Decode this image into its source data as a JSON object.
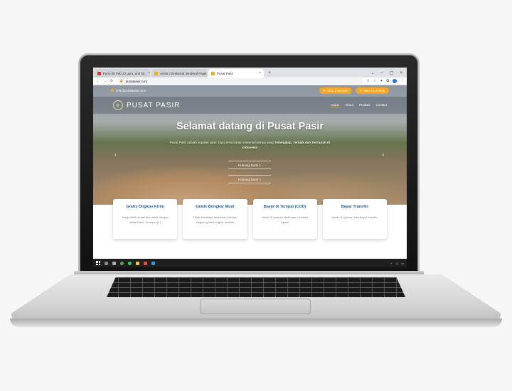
{
  "browser": {
    "tabs": [
      {
        "label": "Form 08 Feb 22 guru_unit 03_",
        "favicon_color": "#d93025",
        "active": false
      },
      {
        "label": "Anisa | Direktorat Jenderal Pajak",
        "favicon_color": "#f4b400",
        "active": false
      },
      {
        "label": "Pusat Pasir",
        "favicon_color": "#f5a623",
        "active": true
      }
    ],
    "new_tab_label": "+",
    "url": "pusatpasir.com"
  },
  "site": {
    "email": "info@pusatpasir.com",
    "phones": [
      "0821-1788-8486",
      "0857-1714-9696"
    ],
    "logo_text": "PUSAT PASIR",
    "menu": [
      "Home",
      "About",
      "Product",
      "Contact"
    ],
    "hero_title": "Selamat datang di Pusat Pasir",
    "hero_sub_plain": "Pusat Pasir adalah supplier pasir, batu serta bahan material lainnya yang",
    "hero_sub_bold": "Terlengkap, Terbaik dan Termurah di Indonesia",
    "hero_buttons": [
      "Hubungi Kami 1",
      "Hubungi Kami 2"
    ],
    "cards": [
      {
        "title": "Gratis Ongkos Kirim",
        "text": "Harga lebih murah jika dekat dengan lokasi Kami, di nego aja !"
      },
      {
        "title": "Gratis Bongkar Muat",
        "text": "Tidak ada biaya tambahan lainnya, langsung kita bongkar muatan"
      },
      {
        "title": "Bayar di Tempat (COD)",
        "text": "Aman & nyaman bisa bayar di lokasi tujuan"
      },
      {
        "title": "Bayar Transfer",
        "text": "Aman & nyaman bisa bayar transfer"
      }
    ]
  },
  "colors": {
    "accent": "#f5a623",
    "card_title": "#1d5fa8"
  }
}
